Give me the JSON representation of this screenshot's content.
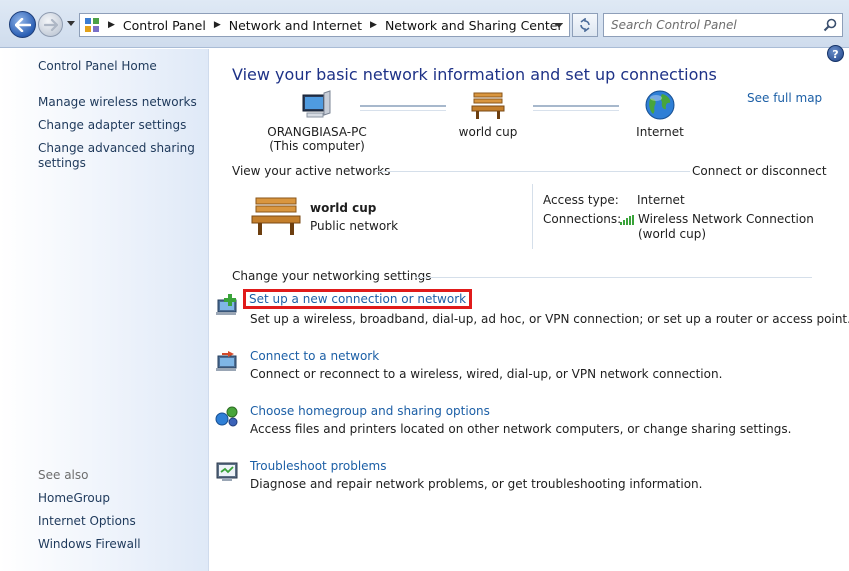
{
  "address_bar": {
    "breadcrumbs": [
      "Control Panel",
      "Network and Internet",
      "Network and Sharing Center"
    ],
    "search_placeholder": "Search Control Panel"
  },
  "sidebar": {
    "home": "Control Panel Home",
    "links": [
      "Manage wireless networks",
      "Change adapter settings",
      "Change advanced sharing settings"
    ],
    "see_also_heading": "See also",
    "see_also": [
      "HomeGroup",
      "Internet Options",
      "Windows Firewall"
    ]
  },
  "main": {
    "title": "View your basic network information and set up connections",
    "see_full_map": "See full map",
    "network_map": {
      "computer_name": "ORANGBIASA-PC",
      "computer_sub": "(This computer)",
      "network_name": "world cup",
      "internet": "Internet"
    },
    "active_networks": {
      "heading": "View your active networks",
      "connect_link": "Connect or disconnect",
      "network_name": "world cup",
      "network_type": "Public network",
      "access_type_label": "Access type:",
      "access_type_value": "Internet",
      "connections_label": "Connections:",
      "connection_line1": "Wireless Network Connection",
      "connection_line2": "(world cup)"
    },
    "settings": {
      "heading": "Change your networking settings",
      "tasks": [
        {
          "link": "Set up a new connection or network",
          "desc": "Set up a wireless, broadband, dial-up, ad hoc, or VPN connection; or set up a router or access point.",
          "icon": "new-connection-icon"
        },
        {
          "link": "Connect to a network",
          "desc": "Connect or reconnect to a wireless, wired, dial-up, or VPN network connection.",
          "icon": "connect-network-icon"
        },
        {
          "link": "Choose homegroup and sharing options",
          "desc": "Access files and printers located on other network computers, or change sharing settings.",
          "icon": "homegroup-icon"
        },
        {
          "link": "Troubleshoot problems",
          "desc": "Diagnose and repair network problems, or get troubleshooting information.",
          "icon": "troubleshoot-icon"
        }
      ]
    }
  },
  "colors": {
    "title": "#1e3287",
    "link": "#1c5fa6",
    "highlight": "#e01b1b"
  }
}
